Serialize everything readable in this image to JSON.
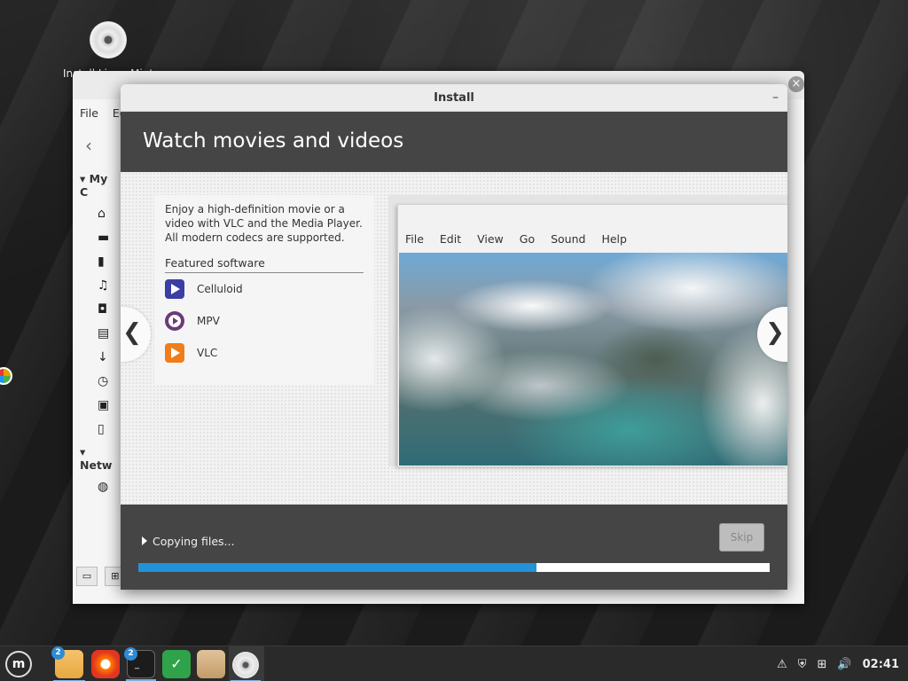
{
  "desktop": {
    "icon_label": "Install Linux Mint"
  },
  "file_manager": {
    "menu": [
      "File",
      "Edit"
    ],
    "back_icon": "chevron-left-icon",
    "section_my_computer": "My C",
    "section_network": "Netw",
    "sidebar_icons": [
      "home-icon",
      "desktop-icon",
      "document-icon",
      "music-icon",
      "camera-icon",
      "video-icon",
      "download-icon",
      "clock-icon",
      "file-system-icon",
      "trash-icon"
    ],
    "network_icon": "globe-icon"
  },
  "installer": {
    "window_title": "Install",
    "minimize_label": "–",
    "heading": "Watch movies and videos",
    "description": "Enjoy a high-definition movie or a video with VLC and the Media Player. All modern codecs are supported.",
    "featured_label": "Featured software",
    "apps": [
      {
        "name": "Celluloid",
        "icon": "celluloid-icon"
      },
      {
        "name": "MPV",
        "icon": "mpv-icon"
      },
      {
        "name": "VLC",
        "icon": "vlc-icon"
      }
    ],
    "player_menu": [
      "File",
      "Edit",
      "View",
      "Go",
      "Sound",
      "Help"
    ],
    "prev_label": "❮",
    "next_label": "❯",
    "status_text": "Copying files...",
    "skip_label": "Skip",
    "progress_percent": 63
  },
  "taskbar": {
    "menu_label": "m",
    "apps": [
      {
        "name": "files",
        "badge": "2"
      },
      {
        "name": "firefox",
        "badge": ""
      },
      {
        "name": "terminal",
        "badge": "2"
      },
      {
        "name": "update-manager",
        "badge": ""
      },
      {
        "name": "archive",
        "badge": ""
      },
      {
        "name": "installer",
        "badge": ""
      }
    ],
    "clock": "02:41"
  }
}
